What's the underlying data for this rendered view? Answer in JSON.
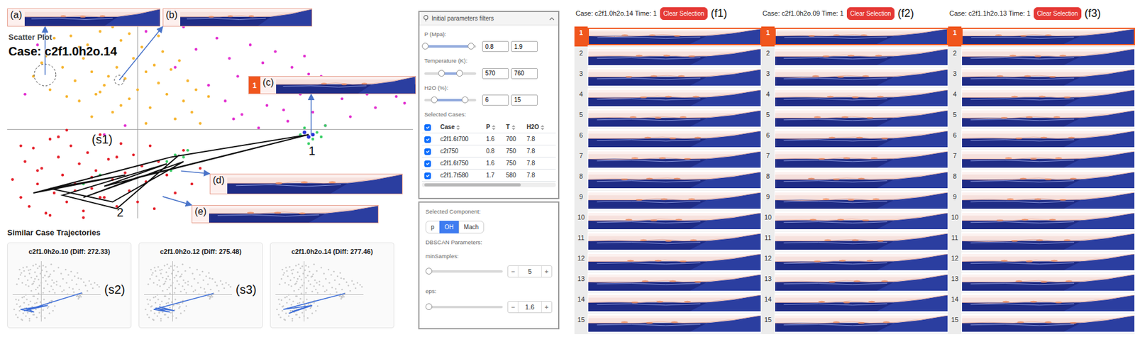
{
  "scatter": {
    "title": "Scatter Plot",
    "case": "Case: c2f1.0h2o.14",
    "crosshair": {
      "x": 33,
      "y": 42.3
    },
    "series": [
      {
        "name": "yellow",
        "color": "#f6b531",
        "x": [
          8,
          10,
          12,
          14,
          15,
          17,
          18,
          19,
          20,
          21,
          22,
          23,
          24,
          25,
          26,
          27,
          28,
          29,
          30,
          31,
          32,
          33,
          34,
          35,
          36,
          37,
          38,
          39,
          40,
          41,
          42,
          43,
          44,
          45,
          46,
          47,
          48,
          50,
          13,
          16,
          22,
          27,
          31,
          35,
          24,
          19,
          29,
          38,
          11,
          26
        ],
        "y": [
          66,
          72,
          60,
          78,
          70,
          84,
          64,
          55,
          74,
          80,
          68,
          58,
          86,
          62,
          76,
          50,
          70,
          82,
          65,
          56,
          74,
          60,
          79,
          68,
          52,
          71,
          63,
          77,
          58,
          69,
          47,
          73,
          55,
          64,
          50,
          60,
          45,
          57,
          83,
          57,
          48,
          88,
          85,
          45,
          59,
          79,
          53,
          84,
          75,
          66
        ]
      },
      {
        "name": "magenta",
        "color": "#e22fd0",
        "x": [
          6,
          9,
          35,
          42,
          47,
          50,
          52,
          54,
          55,
          57,
          58,
          60,
          61,
          63,
          64,
          66,
          67,
          69,
          70,
          72,
          73,
          75,
          77,
          78,
          80,
          82,
          84,
          86,
          88,
          90,
          92,
          95,
          97,
          56,
          62,
          68,
          74,
          30,
          25,
          44
        ],
        "y": [
          58,
          80,
          86,
          70,
          78,
          62,
          83,
          55,
          74,
          66,
          49,
          80,
          60,
          72,
          53,
          77,
          64,
          46,
          70,
          58,
          75,
          50,
          66,
          44,
          61,
          56,
          48,
          63,
          58,
          52,
          60,
          57,
          54,
          47,
          43,
          51,
          67,
          44,
          40,
          88
        ]
      },
      {
        "name": "red",
        "color": "#e5222c",
        "x": [
          3,
          5,
          6,
          7,
          8,
          9,
          10,
          11,
          12,
          13,
          14,
          15,
          16,
          17,
          18,
          19,
          20,
          21,
          22,
          23,
          24,
          25,
          26,
          27,
          28,
          29,
          30,
          31,
          32,
          33,
          34,
          35,
          36,
          37,
          38,
          40,
          42,
          44,
          46,
          48,
          12,
          16,
          20,
          24,
          9,
          14,
          28,
          18,
          22,
          5
        ],
        "y": [
          20,
          12,
          28,
          8,
          34,
          18,
          25,
          5,
          38,
          14,
          30,
          22,
          10,
          35,
          18,
          27,
          6,
          32,
          16,
          24,
          40,
          12,
          29,
          20,
          8,
          36,
          23,
          15,
          31,
          10,
          26,
          19,
          35,
          7,
          28,
          22,
          14,
          33,
          18,
          25,
          4,
          42,
          3,
          12,
          24,
          39,
          30,
          15,
          21,
          35
        ]
      },
      {
        "name": "green",
        "color": "#3ccf68",
        "x": [
          72,
          73,
          75,
          76,
          77,
          78,
          74,
          40,
          42,
          44,
          41,
          45,
          24,
          20
        ],
        "y": [
          40,
          43,
          38,
          41,
          39,
          44,
          36,
          28,
          31,
          30,
          24,
          33,
          22,
          18
        ]
      },
      {
        "name": "blue",
        "color": "#2a32d8",
        "x": [
          73,
          75,
          74
        ],
        "y": [
          41,
          40,
          39
        ]
      }
    ],
    "trajectory": {
      "x": [
        74,
        41,
        8,
        30,
        12,
        27,
        44,
        20,
        33,
        74,
        25,
        40,
        15,
        28,
        43
      ],
      "y": [
        40,
        30,
        14,
        22,
        16,
        10,
        28,
        12,
        21,
        40,
        17,
        27,
        13,
        7,
        31
      ]
    },
    "marks": [
      {
        "text": "(s1)",
        "x": 22,
        "y": 36
      },
      {
        "text": "1",
        "x": 74,
        "y": 31
      },
      {
        "text": "2",
        "x": 28,
        "y": 3.5
      }
    ],
    "annotations": [
      {
        "label": "(a)",
        "x": 10.8,
        "y": 66.6,
        "circled": true
      },
      {
        "label": "(b)",
        "x": 28.6,
        "y": 64.3,
        "circled": true
      },
      {
        "label": "(c)",
        "badge": "1",
        "x": 74.6,
        "y": 40,
        "circled": false
      },
      {
        "label": "(d)",
        "x": 43.4,
        "y": 23.8,
        "circled": false
      },
      {
        "label": "(e)",
        "x": 39,
        "y": 12.4,
        "circled": false
      }
    ]
  },
  "similar": {
    "title": "Similar Case Trajectories",
    "cards": [
      {
        "title": "c2f1.0h2o.10 (Diff: 272.33)",
        "label": "(s2)",
        "x": [
          78,
          14,
          40,
          10,
          25,
          16
        ],
        "y": [
          45,
          18,
          26,
          20,
          16,
          22
        ]
      },
      {
        "title": "c2f1.0h2o.12 (Diff: 275.48)",
        "label": "(s3)",
        "x": [
          78,
          12,
          30,
          14,
          35,
          18,
          28
        ],
        "y": [
          44,
          20,
          16,
          22,
          18,
          24,
          20
        ]
      },
      {
        "title": "c2f1.0h2o.14 (Diff: 277.46)",
        "x": [
          78,
          10,
          42,
          16,
          36,
          20
        ],
        "y": [
          44,
          20,
          26,
          14,
          24,
          17
        ]
      }
    ]
  },
  "filters": {
    "title": "Initial parameters filters",
    "params": [
      {
        "label": "P (Mpa):",
        "low": "0.8",
        "high": "1.9",
        "lowLevel": 0.01,
        "highLevel": 0.89
      },
      {
        "label": "Temperature (K):",
        "low": "570",
        "high": "760",
        "lowLevel": 0.32,
        "highLevel": 0.68
      },
      {
        "label": "H2O (%):",
        "low": "6",
        "high": "15",
        "lowLevel": 0.19,
        "highLevel": 0.78
      }
    ],
    "casesLabel": "Selected Cases:",
    "allChecked": true,
    "columns": [
      "Case",
      "P",
      "T",
      "H2O"
    ],
    "rows": [
      {
        "cells": [
          "c2f1.6t700",
          "1.6",
          "700",
          "7.8"
        ],
        "checked": true
      },
      {
        "cells": [
          "c2t750",
          "0.8",
          "750",
          "7.8"
        ],
        "checked": true
      },
      {
        "cells": [
          "c2f1.6t750",
          "1.6",
          "750",
          "7.8"
        ],
        "checked": true
      },
      {
        "cells": [
          "c2f1.7t580",
          "1.7",
          "580",
          "7.8"
        ],
        "checked": true
      }
    ]
  },
  "component": {
    "label": "Selected Component:",
    "options": [
      {
        "label": "p",
        "selected": false
      },
      {
        "label": "OH",
        "selected": true
      },
      {
        "label": "Mach",
        "selected": false
      }
    ]
  },
  "dbscan": {
    "label": "DBSCAN Parameters:",
    "params": [
      {
        "label": "minSamples:",
        "value": "5",
        "level": 0,
        "minus": "−",
        "plus": "+"
      },
      {
        "label": "eps:",
        "value": "1.6",
        "level": 0,
        "minus": "−",
        "plus": "+"
      }
    ]
  },
  "frames": {
    "columns": [
      {
        "case": "Case: c2f1.0h2o.14 Time: 1",
        "button": "Clear Selection",
        "tag": "(f1)",
        "frames": [
          {
            "n": "1",
            "selected": true
          },
          {
            "n": "2",
            "selected": false
          },
          {
            "n": "3",
            "selected": false
          },
          {
            "n": "4",
            "selected": false
          },
          {
            "n": "5",
            "selected": false
          },
          {
            "n": "6",
            "selected": false
          },
          {
            "n": "7",
            "selected": false
          },
          {
            "n": "8",
            "selected": false
          },
          {
            "n": "9",
            "selected": false
          },
          {
            "n": "10",
            "selected": false
          },
          {
            "n": "11",
            "selected": false
          },
          {
            "n": "12",
            "selected": false
          },
          {
            "n": "13",
            "selected": false
          },
          {
            "n": "14",
            "selected": false
          },
          {
            "n": "15",
            "selected": false
          }
        ]
      },
      {
        "case": "Case: c2f1.0h2o.09 Time: 1",
        "button": "Clear Selection",
        "tag": "(f2)",
        "frames": [
          {
            "n": "1",
            "selected": true
          },
          {
            "n": "2",
            "selected": false
          },
          {
            "n": "3",
            "selected": false
          },
          {
            "n": "4",
            "selected": false
          },
          {
            "n": "5",
            "selected": false
          },
          {
            "n": "6",
            "selected": false
          },
          {
            "n": "7",
            "selected": false
          },
          {
            "n": "8",
            "selected": false
          },
          {
            "n": "9",
            "selected": false
          },
          {
            "n": "10",
            "selected": false
          },
          {
            "n": "11",
            "selected": false
          },
          {
            "n": "12",
            "selected": false
          },
          {
            "n": "13",
            "selected": false
          },
          {
            "n": "14",
            "selected": false
          },
          {
            "n": "15",
            "selected": false
          }
        ]
      },
      {
        "case": "Case: c2f1.1h2o.13 Time: 1",
        "button": "Clear Selection",
        "tag": "(f3)",
        "frames": [
          {
            "n": "1",
            "selected": true
          },
          {
            "n": "2",
            "selected": false
          },
          {
            "n": "3",
            "selected": false
          },
          {
            "n": "4",
            "selected": false
          },
          {
            "n": "5",
            "selected": false
          },
          {
            "n": "6",
            "selected": false
          },
          {
            "n": "7",
            "selected": false
          },
          {
            "n": "8",
            "selected": false
          },
          {
            "n": "9",
            "selected": false
          },
          {
            "n": "10",
            "selected": false
          },
          {
            "n": "11",
            "selected": false
          },
          {
            "n": "12",
            "selected": false
          },
          {
            "n": "13",
            "selected": false
          },
          {
            "n": "14",
            "selected": false
          },
          {
            "n": "15",
            "selected": false
          }
        ]
      }
    ]
  }
}
